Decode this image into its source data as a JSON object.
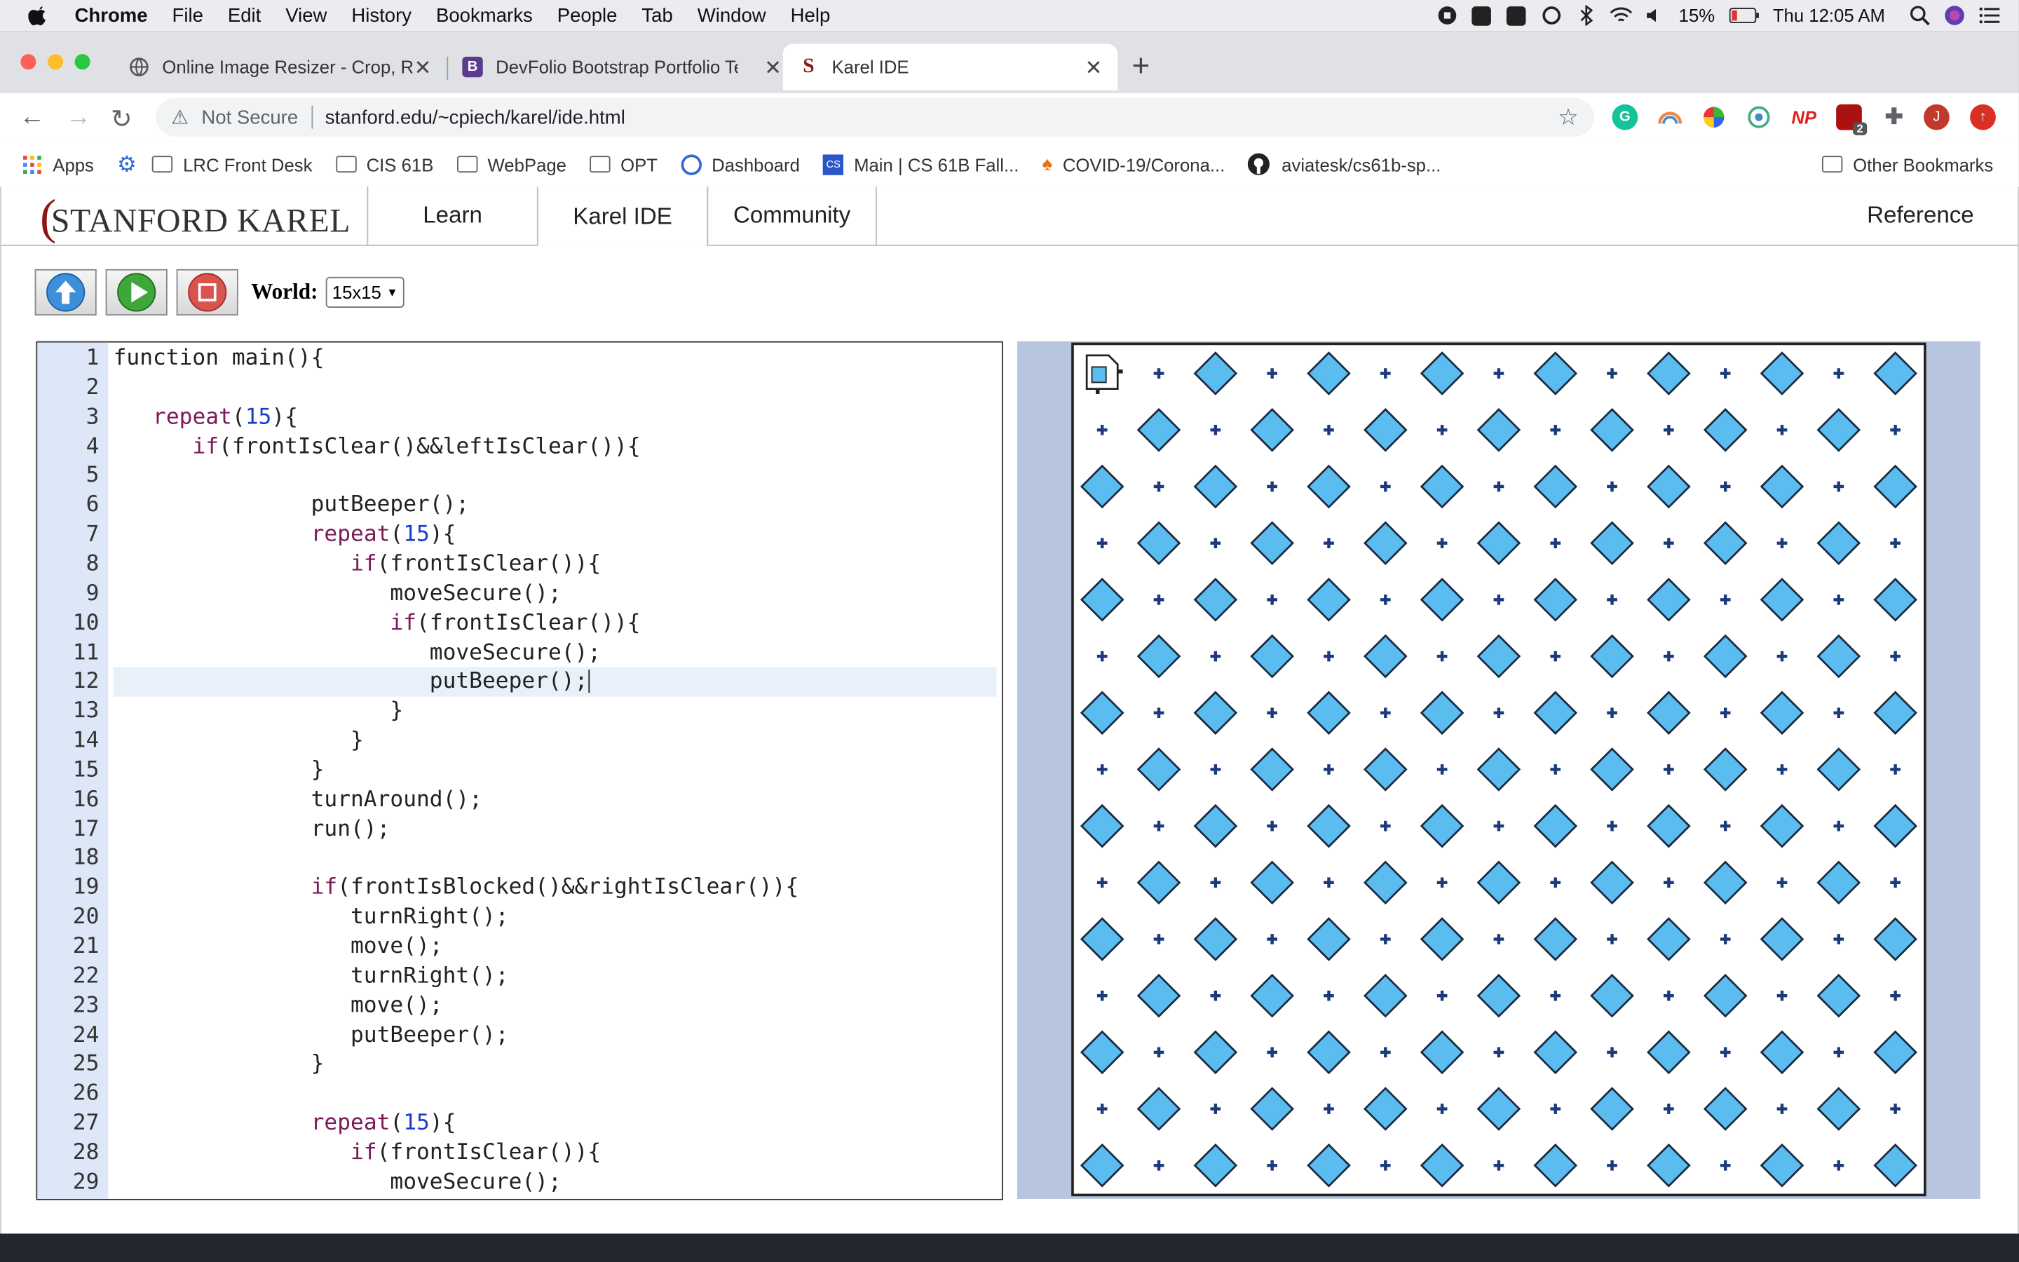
{
  "menubar": {
    "app": "Chrome",
    "items": [
      "File",
      "Edit",
      "View",
      "History",
      "Bookmarks",
      "People",
      "Tab",
      "Window",
      "Help"
    ],
    "battery": "15%",
    "clock": "Thu 12:05 AM"
  },
  "tabs": [
    {
      "title": "Online Image Resizer - Crop, R"
    },
    {
      "title": "DevFolio Bootstrap Portfolio Te"
    },
    {
      "title": "Karel IDE"
    }
  ],
  "address": {
    "security": "Not Secure",
    "url": "stanford.edu/~cpiech/karel/ide.html"
  },
  "extensions": {
    "np": "NP",
    "badge": "2",
    "profile": "J"
  },
  "bookmarks": {
    "items": [
      "Apps",
      "LRC Front Desk",
      "CIS 61B",
      "WebPage",
      "OPT",
      "Dashboard",
      "Main | CS 61B Fall...",
      "COVID-19/Corona...",
      "aviatesk/cs61b-sp..."
    ],
    "other": "Other Bookmarks"
  },
  "site": {
    "logo": "STANFORD KAREL",
    "nav": [
      "Learn",
      "Karel IDE",
      "Community"
    ],
    "reference": "Reference"
  },
  "controls": {
    "world_label": "World:",
    "world_value": "15x15"
  },
  "editor": {
    "highlighted_line": 12,
    "lines": [
      "function main(){",
      "",
      "   repeat(15){",
      "      if(frontIsClear()&&leftIsClear()){",
      "",
      "               putBeeper();",
      "               repeat(15){",
      "                  if(frontIsClear()){",
      "                     moveSecure();",
      "                     if(frontIsClear()){",
      "                        moveSecure();",
      "                        putBeeper();",
      "                     }",
      "                  }",
      "               }",
      "               turnAround();",
      "               run();",
      "",
      "               if(frontIsBlocked()&&rightIsClear()){",
      "                  turnRight();",
      "                  move();",
      "                  turnRight();",
      "                  move();",
      "                  putBeeper();",
      "               }",
      "",
      "               repeat(15){",
      "                  if(frontIsClear()){",
      "                     moveSecure();"
    ]
  },
  "world": {
    "rows": 15,
    "cols": 15,
    "beeper_color": "#5bbcf0",
    "karel_position": [
      1,
      1
    ],
    "karel_facing": "east"
  },
  "colors": {
    "stanford_red": "#8c1515",
    "world_bg": "#b7c6de",
    "gutter_bg": "#dde7f7"
  }
}
